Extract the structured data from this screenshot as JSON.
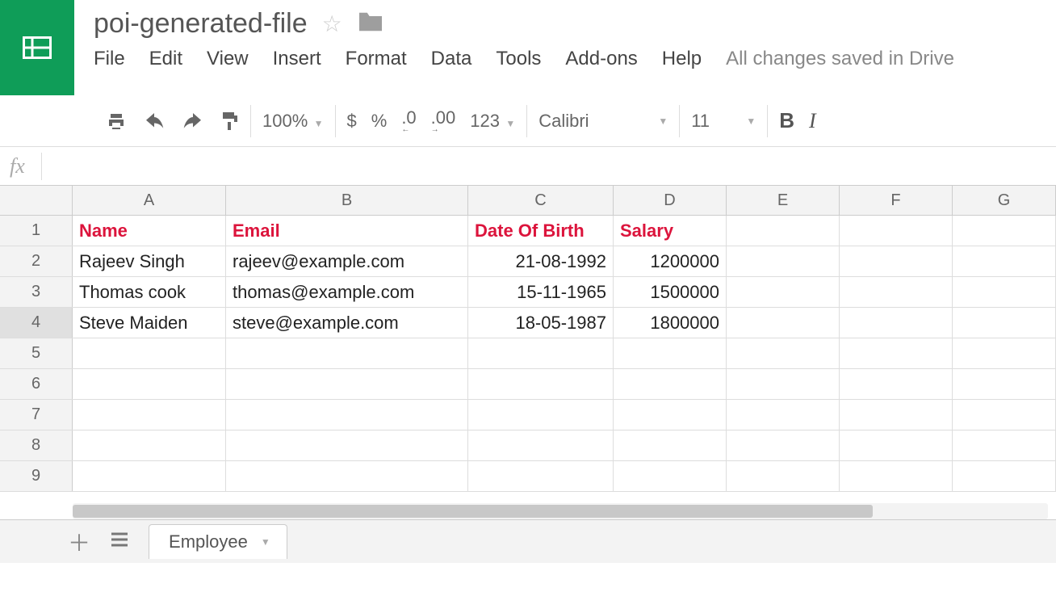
{
  "doc": {
    "title": "poi-generated-file",
    "save_status": "All changes saved in Drive"
  },
  "menu": {
    "file": "File",
    "edit": "Edit",
    "view": "View",
    "insert": "Insert",
    "format": "Format",
    "data": "Data",
    "tools": "Tools",
    "addons": "Add-ons",
    "help": "Help"
  },
  "toolbar": {
    "zoom": "100%",
    "currency": "$",
    "percent": "%",
    "dec_less": ".0",
    "dec_more": ".00",
    "numfmt": "123",
    "font": "Calibri",
    "size": "11",
    "bold": "B",
    "italic": "I"
  },
  "fx": {
    "label": "fx",
    "value": ""
  },
  "columns": [
    "A",
    "B",
    "C",
    "D",
    "E",
    "F",
    "G"
  ],
  "row_numbers": [
    "1",
    "2",
    "3",
    "4",
    "5",
    "6",
    "7",
    "8",
    "9"
  ],
  "sheet": {
    "headers": {
      "name": "Name",
      "email": "Email",
      "dob": "Date Of Birth",
      "salary": "Salary"
    },
    "rows": [
      {
        "name": "Rajeev Singh",
        "email": "rajeev@example.com",
        "dob": "21-08-1992",
        "salary": "1200000"
      },
      {
        "name": "Thomas cook",
        "email": "thomas@example.com",
        "dob": "15-11-1965",
        "salary": "1500000"
      },
      {
        "name": "Steve Maiden",
        "email": "steve@example.com",
        "dob": "18-05-1987",
        "salary": "1800000"
      }
    ]
  },
  "sheets_bar": {
    "tab": "Employee"
  }
}
